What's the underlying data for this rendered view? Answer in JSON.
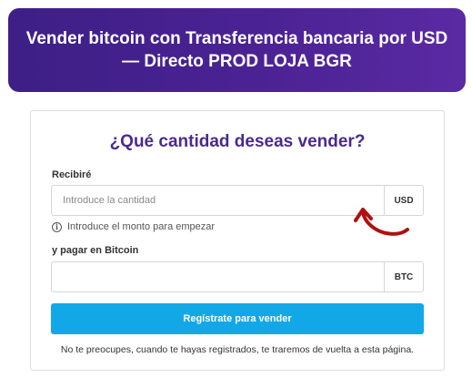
{
  "banner": {
    "title": "Vender bitcoin con Transferencia bancaria por USD — Directo PROD LOJA BGR"
  },
  "form": {
    "title": "¿Qué cantidad deseas vender?",
    "receive_label": "Recibiré",
    "receive_placeholder": "Introduce la cantidad",
    "receive_value": "",
    "receive_currency": "USD",
    "hint_text": "Introduce el monto para empezar",
    "pay_label": "y pagar en Bitcoin",
    "pay_value": "",
    "pay_currency": "BTC",
    "register_button_label": "Regístrate para vender",
    "footer_note": "No te preocupes, cuando te hayas registrados, te traremos de vuelta a esta página."
  },
  "icons": {
    "hint_icon": "info-icon",
    "arrow": "curved-arrow-pointer"
  },
  "colors": {
    "banner_start": "#3d1f86",
    "banner_end": "#5a2aa3",
    "title_purple": "#4a2a8f",
    "button_blue": "#12a8e8",
    "arrow_red": "#b01010"
  }
}
